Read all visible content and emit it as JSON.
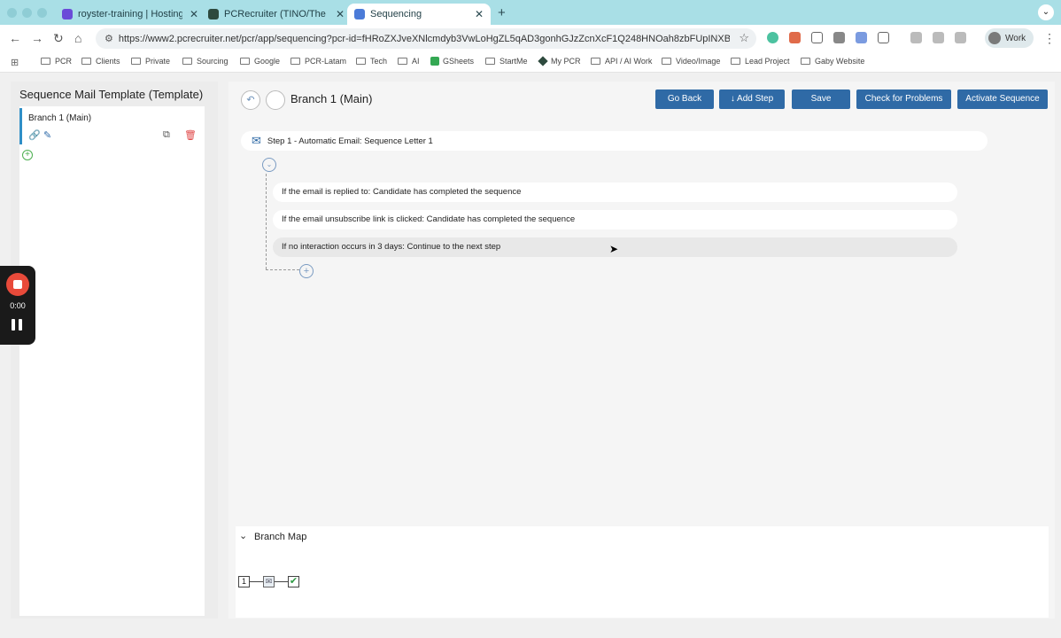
{
  "browser": {
    "tabs": [
      {
        "title": "royster-training | Hostinger W",
        "active": false,
        "favicon_color": "#6a4bd8"
      },
      {
        "title": "PCRecruiter (TINO/The Royste",
        "active": false,
        "favicon_color": "#2e4a3e"
      },
      {
        "title": "Sequencing",
        "active": true,
        "favicon_color": "#4b7bd8"
      }
    ],
    "close_glyph": "✕",
    "new_tab_glyph": "+",
    "url": "https://www2.pcrecruiter.net/pcr/app/sequencing?pcr-id=fHRoZXJveXNlcmdyb3VwLoHgZL5qAD3gonhGJzZcnXcF1Q248HNOah8zbFUpINXBJnV3v...",
    "profile_label": "Work",
    "bookmarks": [
      {
        "label": "PCR",
        "kind": "folder"
      },
      {
        "label": "Clients",
        "kind": "folder"
      },
      {
        "label": "Private",
        "kind": "folder"
      },
      {
        "label": "Sourcing",
        "kind": "folder"
      },
      {
        "label": "Google",
        "kind": "folder"
      },
      {
        "label": "PCR-Latam",
        "kind": "folder"
      },
      {
        "label": "Tech",
        "kind": "folder"
      },
      {
        "label": "AI",
        "kind": "folder"
      },
      {
        "label": "GSheets",
        "kind": "sheets"
      },
      {
        "label": "StartMe",
        "kind": "folder"
      },
      {
        "label": "My PCR",
        "kind": "pcr"
      },
      {
        "label": "API / AI Work",
        "kind": "folder"
      },
      {
        "label": "Video/Image",
        "kind": "folder"
      },
      {
        "label": "Lead Project",
        "kind": "folder"
      },
      {
        "label": "Gaby Website",
        "kind": "folder"
      }
    ]
  },
  "recorder": {
    "time": "0:00",
    "stop_color": "#e84a3a"
  },
  "sidebar": {
    "title": "Sequence Mail Template (Template)",
    "branches": [
      {
        "label": "Branch 1 (Main)"
      }
    ]
  },
  "main": {
    "branch_title": "Branch 1 (Main)",
    "buttons": {
      "go_back": "Go Back",
      "add_step": "↓ Add Step",
      "save": "Save",
      "check": "Check for Problems",
      "activate": "Activate Sequence"
    },
    "step": {
      "label": "Step 1 - Automatic Email: Sequence Letter 1"
    },
    "conditions": [
      "If the email is replied to: Candidate has completed the sequence",
      "If the email unsubscribe link is clicked: Candidate has completed the sequence",
      "If no interaction occurs in 3 days: Continue to the next step"
    ]
  },
  "branch_map": {
    "title": "Branch Map",
    "start_node": "1"
  },
  "colors": {
    "accent": "#2f6aa6",
    "chrome": "#a9dfe6",
    "selection_bar": "#2f8fc7",
    "delete": "#e04848"
  }
}
